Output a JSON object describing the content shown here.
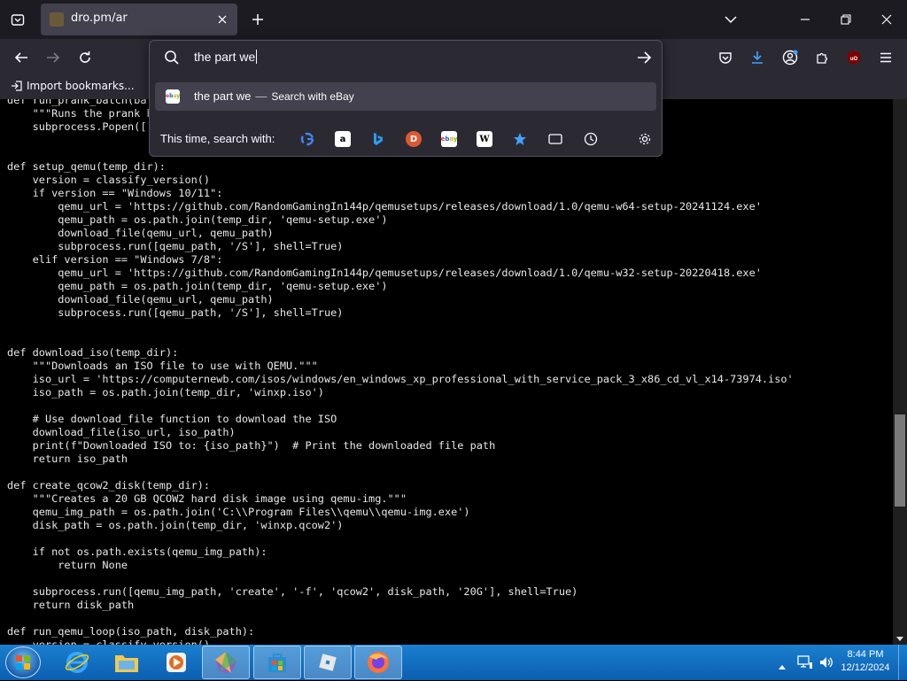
{
  "browser": {
    "tab": {
      "title": "dro.pm/ar"
    },
    "urlbar": {
      "query": "the part we",
      "suggestion": {
        "query": "the part we",
        "separator": "—",
        "action": "Search with eBay",
        "engine_icon": "ebay-icon"
      },
      "oneoff_label": "This time, search with:",
      "oneoff_engines": [
        "google",
        "amazon",
        "bing",
        "duckduckgo",
        "ebay",
        "wikipedia",
        "bookmarks",
        "tabs",
        "history",
        "settings"
      ]
    },
    "bookmarks_bar": {
      "import_label": "Import bookmarks..."
    },
    "accent": "#0060df"
  },
  "code": {
    "lines": [
      "def run_prank_batch(bat",
      "    \"\"\"Runs the prank b",
      "    subprocess.Popen(['",
      "",
      "",
      "def setup_qemu(temp_dir):",
      "    version = classify_version()",
      "    if version == \"Windows 10/11\":",
      "        qemu_url = 'https://github.com/RandomGamingIn144p/qemusetups/releases/download/1.0/qemu-w64-setup-20241124.exe'",
      "        qemu_path = os.path.join(temp_dir, 'qemu-setup.exe')",
      "        download_file(qemu_url, qemu_path)",
      "        subprocess.run([qemu_path, '/S'], shell=True)",
      "    elif version == \"Windows 7/8\":",
      "        qemu_url = 'https://github.com/RandomGamingIn144p/qemusetups/releases/download/1.0/qemu-w32-setup-20220418.exe'",
      "        qemu_path = os.path.join(temp_dir, 'qemu-setup.exe')",
      "        download_file(qemu_url, qemu_path)",
      "        subprocess.run([qemu_path, '/S'], shell=True)",
      "",
      "",
      "def download_iso(temp_dir):",
      "    \"\"\"Downloads an ISO file to use with QEMU.\"\"\"",
      "    iso_url = 'https://computernewb.com/isos/windows/en_windows_xp_professional_with_service_pack_3_x86_cd_vl_x14-73974.iso'",
      "    iso_path = os.path.join(temp_dir, 'winxp.iso')",
      "",
      "    # Use download_file function to download the ISO",
      "    download_file(iso_url, iso_path)",
      "    print(f\"Downloaded ISO to: {iso_path}\")  # Print the downloaded file path",
      "    return iso_path",
      "",
      "def create_qcow2_disk(temp_dir):",
      "    \"\"\"Creates a 20 GB QCOW2 hard disk image using qemu-img.\"\"\"",
      "    qemu_img_path = os.path.join('C:\\\\Program Files\\\\qemu\\\\qemu-img.exe')",
      "    disk_path = os.path.join(temp_dir, 'winxp.qcow2')",
      "",
      "    if not os.path.exists(qemu_img_path):",
      "        return None",
      "",
      "    subprocess.run([qemu_img_path, 'create', '-f', 'qcow2', disk_path, '20G'], shell=True)",
      "    return disk_path",
      "",
      "def run_qemu_loop(iso_path, disk_path):",
      "    version = classify_version()"
    ]
  },
  "taskbar": {
    "apps": [
      "internet-explorer",
      "file-explorer",
      "media-player",
      "paint-app",
      "store-app",
      "roblox-app",
      "firefox"
    ],
    "clock": {
      "time": "8:44 PM",
      "date": "12/12/2024"
    }
  }
}
